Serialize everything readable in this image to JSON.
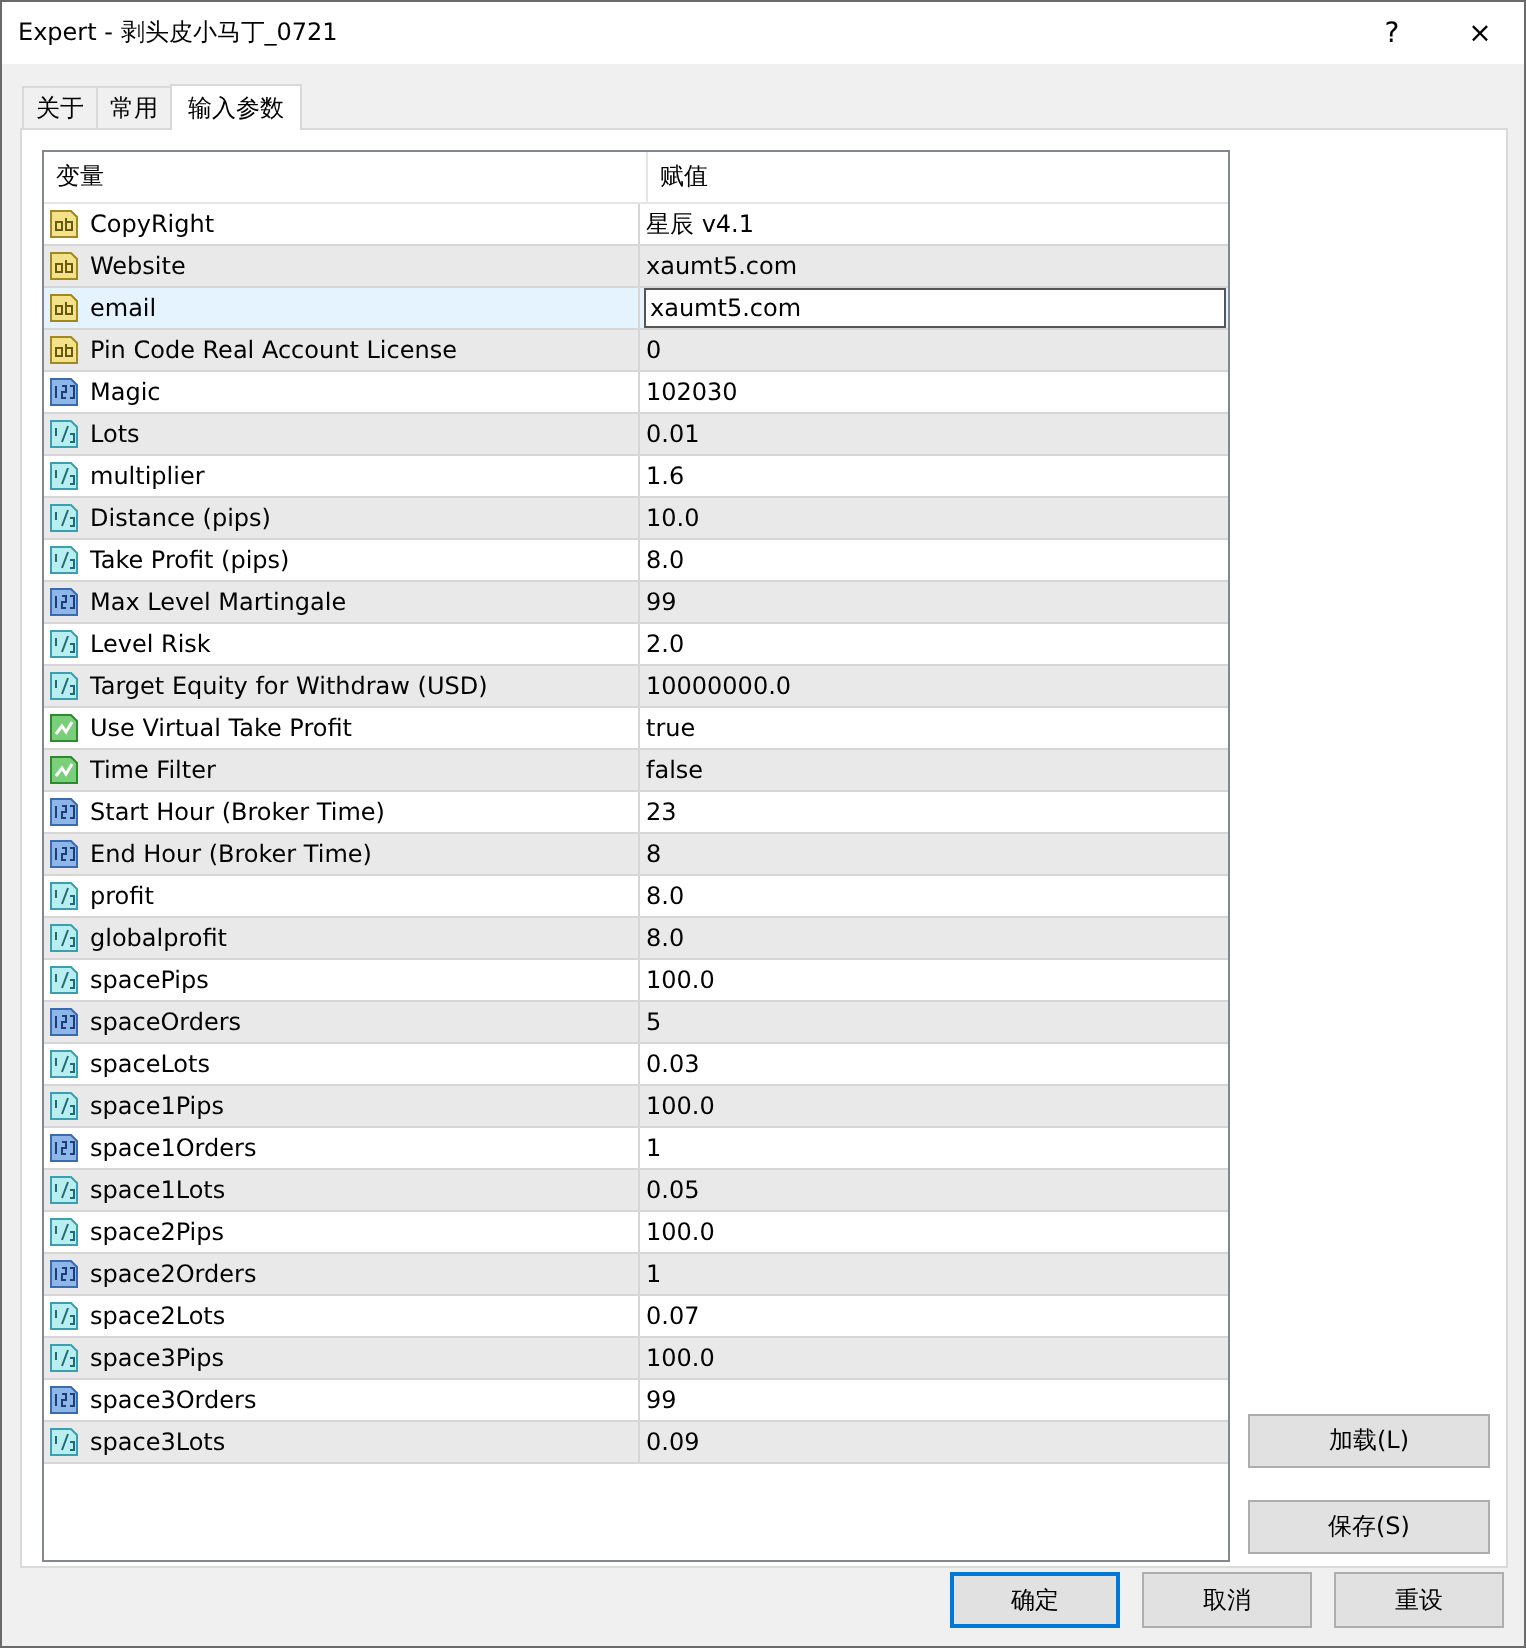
{
  "window": {
    "title": "Expert - 剥头皮小马丁_0721",
    "help": "?",
    "close": "×"
  },
  "tabs": [
    {
      "label": "关于",
      "selected": false
    },
    {
      "label": "常用",
      "selected": false
    },
    {
      "label": "输入参数",
      "selected": true
    }
  ],
  "table": {
    "columns": [
      "变量",
      "赋值"
    ],
    "rows": [
      {
        "kind": "string",
        "name": "CopyRight",
        "value": "星辰 v4.1",
        "selected": false
      },
      {
        "kind": "string",
        "name": "Website",
        "value": "xaumt5.com",
        "selected": false
      },
      {
        "kind": "string",
        "name": "email",
        "value": "xaumt5.com",
        "selected": true
      },
      {
        "kind": "string",
        "name": "Pin Code Real Account License",
        "value": "0",
        "selected": false
      },
      {
        "kind": "integer",
        "name": "Magic",
        "value": "102030",
        "selected": false
      },
      {
        "kind": "double",
        "name": "Lots",
        "value": "0.01",
        "selected": false
      },
      {
        "kind": "double",
        "name": "multiplier",
        "value": "1.6",
        "selected": false
      },
      {
        "kind": "double",
        "name": "Distance (pips)",
        "value": "10.0",
        "selected": false
      },
      {
        "kind": "double",
        "name": "Take Profit (pips)",
        "value": "8.0",
        "selected": false
      },
      {
        "kind": "integer",
        "name": "Max Level Martingale",
        "value": "99",
        "selected": false
      },
      {
        "kind": "double",
        "name": "Level Risk",
        "value": "2.0",
        "selected": false
      },
      {
        "kind": "double",
        "name": "Target Equity for Withdraw (USD)",
        "value": "10000000.0",
        "selected": false
      },
      {
        "kind": "bool",
        "name": "Use Virtual Take Profit",
        "value": "true",
        "selected": false
      },
      {
        "kind": "bool",
        "name": "Time Filter",
        "value": "false",
        "selected": false
      },
      {
        "kind": "integer",
        "name": "Start Hour (Broker Time)",
        "value": "23",
        "selected": false
      },
      {
        "kind": "integer",
        "name": "End Hour (Broker Time)",
        "value": "8",
        "selected": false
      },
      {
        "kind": "double",
        "name": "profit",
        "value": "8.0",
        "selected": false
      },
      {
        "kind": "double",
        "name": "globalprofit",
        "value": "8.0",
        "selected": false
      },
      {
        "kind": "double",
        "name": "spacePips",
        "value": "100.0",
        "selected": false
      },
      {
        "kind": "integer",
        "name": "spaceOrders",
        "value": "5",
        "selected": false
      },
      {
        "kind": "double",
        "name": "spaceLots",
        "value": "0.03",
        "selected": false
      },
      {
        "kind": "double",
        "name": "space1Pips",
        "value": "100.0",
        "selected": false
      },
      {
        "kind": "integer",
        "name": "space1Orders",
        "value": "1",
        "selected": false
      },
      {
        "kind": "double",
        "name": "space1Lots",
        "value": "0.05",
        "selected": false
      },
      {
        "kind": "double",
        "name": "space2Pips",
        "value": "100.0",
        "selected": false
      },
      {
        "kind": "integer",
        "name": "space2Orders",
        "value": "1",
        "selected": false
      },
      {
        "kind": "double",
        "name": "space2Lots",
        "value": "0.07",
        "selected": false
      },
      {
        "kind": "double",
        "name": "space3Pips",
        "value": "100.0",
        "selected": false
      },
      {
        "kind": "integer",
        "name": "space3Orders",
        "value": "99",
        "selected": false
      },
      {
        "kind": "double",
        "name": "space3Lots",
        "value": "0.09",
        "selected": false
      }
    ]
  },
  "side_buttons": [
    "加载(L)",
    "保存(S)"
  ],
  "buttons": [
    {
      "label": "确定",
      "default": true
    },
    {
      "label": "取消",
      "default": false
    },
    {
      "label": "重设",
      "default": false
    }
  ]
}
